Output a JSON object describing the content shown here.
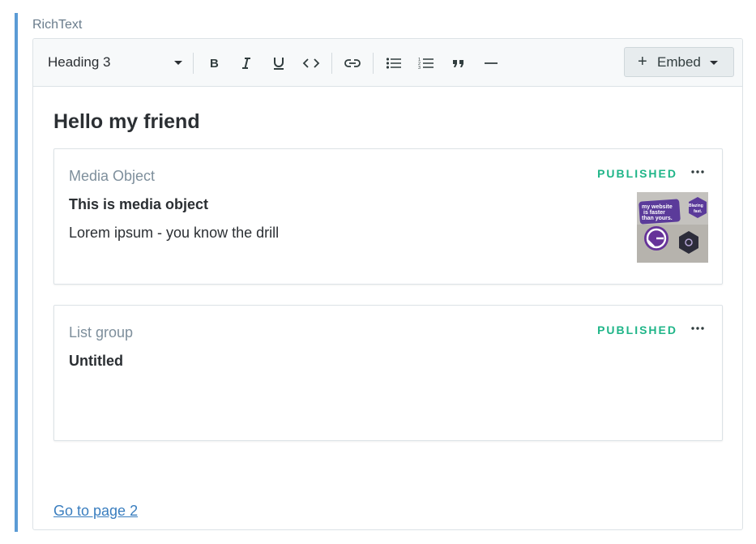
{
  "field": {
    "label": "RichText"
  },
  "toolbar": {
    "block_style": "Heading 3",
    "tools": [
      {
        "name": "bold-icon",
        "tooltip": "Bold"
      },
      {
        "name": "italic-icon",
        "tooltip": "Italic"
      },
      {
        "name": "underline-icon",
        "tooltip": "Underline"
      },
      {
        "name": "code-icon",
        "tooltip": "Code"
      },
      {
        "name": "link-icon",
        "tooltip": "Link"
      },
      {
        "name": "bulleted-list-icon",
        "tooltip": "Bulleted list"
      },
      {
        "name": "numbered-list-icon",
        "tooltip": "Numbered list"
      },
      {
        "name": "quote-icon",
        "tooltip": "Quote"
      },
      {
        "name": "horizontal-rule-icon",
        "tooltip": "Horizontal rule"
      }
    ],
    "embed_label": "Embed"
  },
  "content": {
    "heading": "Hello my friend",
    "cards": [
      {
        "type": "Media Object",
        "status": "PUBLISHED",
        "title": "This is media object",
        "body": "Lorem ipsum - you know the drill",
        "thumbnail": {
          "sticker_texts": [
            "my website",
            "is faster",
            "than yours.",
            "Blazing",
            "fast."
          ]
        }
      },
      {
        "type": "List group",
        "status": "PUBLISHED",
        "title": "Untitled",
        "body": ""
      }
    ],
    "link": "Go to page 2"
  },
  "colors": {
    "accent": "#5b9bd5",
    "published": "#1fb588",
    "link": "#3a7ebf"
  }
}
